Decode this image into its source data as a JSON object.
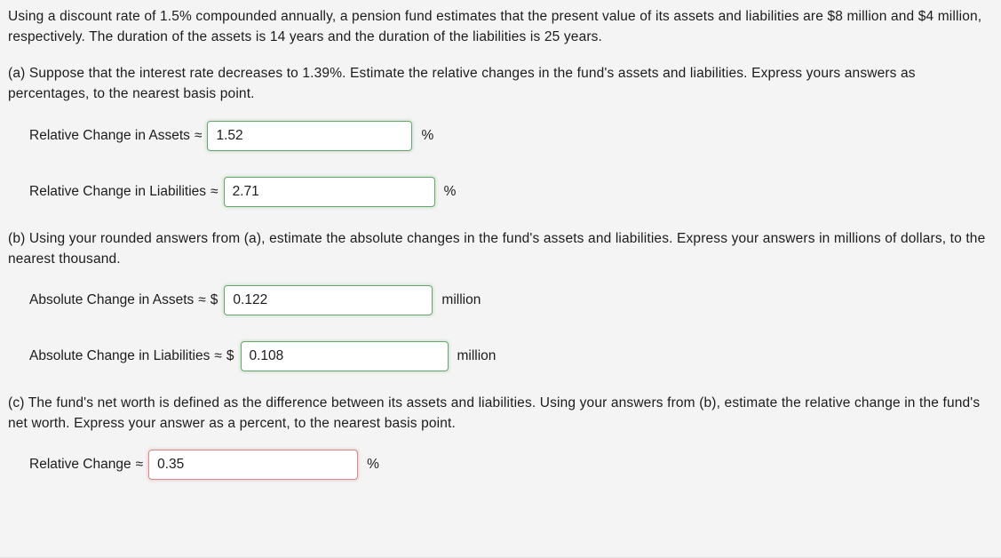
{
  "problem": {
    "intro": "Using a discount rate of 1.5% compounded annually, a pension fund estimates that the present value of its assets and liabilities are $8 million and $4 million, respectively. The duration of the assets is 14 years and the duration of the liabilities is 25 years.",
    "part_a_prompt": "(a) Suppose that the interest rate decreases to 1.39%. Estimate the relative changes in the fund's assets and liabilities. Express yours answers as percentages, to the nearest basis point.",
    "part_b_prompt": "(b) Using your rounded answers from (a), estimate the absolute changes in the fund's assets and liabilities. Express your answers in millions of dollars, to the nearest thousand.",
    "part_c_prompt": "(c) The fund's net worth is defined as the difference between its assets and liabilities. Using your answers from (b), estimate the relative change in the fund's net worth. Express your answer as a percent, to the nearest basis point."
  },
  "answers": [
    {
      "id": "relative-change-assets",
      "label": "Relative Change in Assets",
      "approx": "≈",
      "prefix": "",
      "value": "1.52",
      "unit": "%",
      "state": "correct",
      "border_color": "#66a86b"
    },
    {
      "id": "relative-change-liabilities",
      "label": "Relative Change in Liabilities",
      "approx": "≈",
      "prefix": "",
      "value": "2.71",
      "unit": "%",
      "state": "correct",
      "border_color": "#66a86b"
    },
    {
      "id": "absolute-change-assets",
      "label": "Absolute Change in Assets",
      "approx": "≈",
      "prefix": "$",
      "value": "0.122",
      "unit": "million",
      "state": "correct",
      "border_color": "#66a86b"
    },
    {
      "id": "absolute-change-liabilities",
      "label": "Absolute Change in Liabilities",
      "approx": "≈",
      "prefix": "$",
      "value": "0.108",
      "unit": "million",
      "state": "correct",
      "border_color": "#66a86b"
    },
    {
      "id": "relative-change-net-worth",
      "label": "Relative Change",
      "approx": "≈",
      "prefix": "",
      "value": "0.35",
      "unit": "%",
      "state": "incorrect",
      "border_color": "#d98a8a"
    }
  ],
  "theme": {
    "background": "#f4f4f4",
    "text": "#1c1c1c",
    "input_background": "#ffffff",
    "correct_border": "#66a86b",
    "incorrect_border": "#d98a8a",
    "rule": "#e3e3e3"
  }
}
